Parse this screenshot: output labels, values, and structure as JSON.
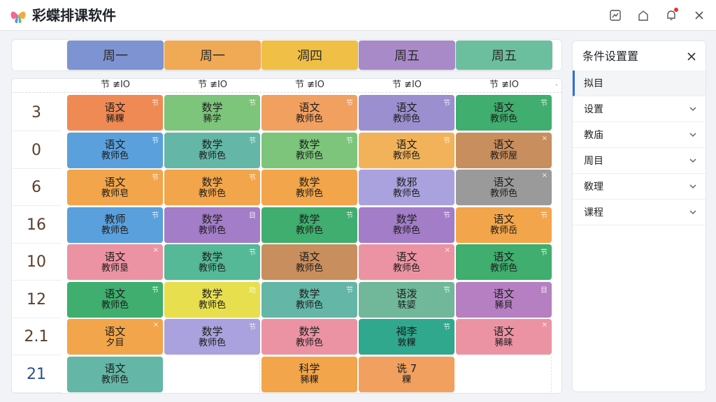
{
  "app": {
    "title": "彩蝶排课软件"
  },
  "colors": {
    "orange": "#f08a55",
    "green": "#7cc57a",
    "amber": "#f2a54a",
    "purple": "#9b8fcf",
    "teal": "#55b896",
    "blue": "#5aa0dc",
    "seagreen": "#64b7a6",
    "brown": "#c98e5d",
    "lavender": "#a79fd9",
    "gray": "#9a9a9a",
    "darkgreen": "#3fae6e",
    "violet": "#a37dc8",
    "pink": "#ec93a3",
    "yellow": "#e8df4f",
    "mauve": "#b67fc2",
    "lightpurple": "#aaa2de",
    "sage": "#71b79a"
  },
  "days": [
    "周一",
    "周一",
    "凋四",
    "周五",
    "周五"
  ],
  "day_colors": [
    "#7e93d1",
    "#f0aa55",
    "#f0bf45",
    "#a98ac9",
    "#6cbf9e"
  ],
  "sub_headers": [
    "节 ≢ΙΟ",
    "节 ≢ΙΟ",
    "节 ≢ΙΟ",
    "节 ≢ΙΟ",
    "节 ≢ΙΟ"
  ],
  "rows": [
    {
      "num": "3",
      "cells": [
        {
          "s": "语文",
          "t": "豨粿",
          "c": "#f08a55",
          "tag": "节"
        },
        {
          "s": "数学",
          "t": "豨学",
          "c": "#7cc57a",
          "tag": "节"
        },
        {
          "s": "语文",
          "t": "教师色",
          "c": "#f2a060",
          "tag": "节"
        },
        {
          "s": "语文",
          "t": "教师色",
          "c": "#9b8fcf",
          "tag": "节"
        },
        {
          "s": "语文",
          "t": "教师色",
          "c": "#3fae6e",
          "tag": "节"
        }
      ]
    },
    {
      "num": "0",
      "cells": [
        {
          "s": "语文",
          "t": "教师色",
          "c": "#5aa0dc",
          "tag": "节"
        },
        {
          "s": "数学",
          "t": "教师色",
          "c": "#64b7a6",
          "tag": "节"
        },
        {
          "s": "数学",
          "t": "教师色",
          "c": "#7cc57a",
          "tag": "节"
        },
        {
          "s": "语文",
          "t": "教师色",
          "c": "#f2b25a",
          "tag": "节"
        },
        {
          "s": "语文",
          "t": "教师屋",
          "c": "#c98e5d",
          "tag": "×"
        }
      ]
    },
    {
      "num": "6",
      "cells": [
        {
          "s": "语文",
          "t": "教师皂",
          "c": "#f2a54a",
          "tag": "节"
        },
        {
          "s": "数学",
          "t": "教师色",
          "c": "#f2a54a",
          "tag": "节"
        },
        {
          "s": "数学",
          "t": "教师色",
          "c": "#f2a54a",
          "tag": ""
        },
        {
          "s": "数邪",
          "t": "教师色",
          "c": "#aaa2de",
          "tag": ""
        },
        {
          "s": "语文",
          "t": "教师色",
          "c": "#9a9a9a",
          "tag": "×"
        }
      ]
    },
    {
      "num": "16",
      "cells": [
        {
          "s": "教师",
          "t": "教师色",
          "c": "#5aa0dc",
          "tag": "节"
        },
        {
          "s": "数学",
          "t": "教师色",
          "c": "#a37dc8",
          "tag": "目"
        },
        {
          "s": "数学",
          "t": "教师色",
          "c": "#3fae6e",
          "tag": "节"
        },
        {
          "s": "数学",
          "t": "教师色",
          "c": "#a37dc8",
          "tag": "节"
        },
        {
          "s": "语文",
          "t": "教师岳",
          "c": "#f2a54a",
          "tag": "节"
        }
      ]
    },
    {
      "num": "10",
      "cells": [
        {
          "s": "语文",
          "t": "教师垦",
          "c": "#ec93a3",
          "tag": "×"
        },
        {
          "s": "数学",
          "t": "教师色",
          "c": "#55b896",
          "tag": "节"
        },
        {
          "s": "语文",
          "t": "教师色",
          "c": "#c98e5d",
          "tag": ""
        },
        {
          "s": "语文",
          "t": "教师色",
          "c": "#ec93a3",
          "tag": "×"
        },
        {
          "s": "语文",
          "t": "教师色",
          "c": "#3fae6e",
          "tag": "节"
        }
      ]
    },
    {
      "num": "12",
      "cells": [
        {
          "s": "语文",
          "t": "教师色",
          "c": "#3fae6e",
          "tag": "节"
        },
        {
          "s": "数学",
          "t": "教师色",
          "c": "#e8df4f",
          "tag": "劝"
        },
        {
          "s": "数学",
          "t": "教师色",
          "c": "#64b7a6",
          "tag": "节"
        },
        {
          "s": "语泼",
          "t": "轶媭",
          "c": "#71b79a",
          "tag": "节"
        },
        {
          "s": "语文",
          "t": "豨貝",
          "c": "#b67fc2",
          "tag": "目"
        }
      ]
    },
    {
      "num": "2.1",
      "cells": [
        {
          "s": "语文",
          "t": "夕目",
          "c": "#f2a54a",
          "tag": "×"
        },
        {
          "s": "数学",
          "t": "教师色",
          "c": "#aaa2de",
          "tag": "节"
        },
        {
          "s": "数学",
          "t": "教师色",
          "c": "#ec93a3",
          "tag": ""
        },
        {
          "s": "褐李",
          "t": "敦粿",
          "c": "#2fa88e",
          "tag": "节"
        },
        {
          "s": "语文",
          "t": "豨睐",
          "c": "#ec93a3",
          "tag": "×"
        }
      ]
    },
    {
      "num": "21",
      "blue": true,
      "cells": [
        {
          "s": "语文",
          "t": "教师色",
          "c": "#64b7a6",
          "tag": ""
        },
        null,
        {
          "s": "科学",
          "t": "豨粿",
          "c": "#f2a54a",
          "tag": ""
        },
        {
          "s": "诜 7",
          "t": "粿",
          "c": "#f2a060",
          "tag": ""
        },
        null
      ]
    }
  ],
  "side_panel": {
    "title": "条件设置置",
    "items": [
      {
        "label": "拟目",
        "active": true,
        "chevron": false
      },
      {
        "label": "设置",
        "active": false,
        "chevron": true
      },
      {
        "label": "教庙",
        "active": false,
        "chevron": true
      },
      {
        "label": "周目",
        "active": false,
        "chevron": true
      },
      {
        "label": "敎理",
        "active": false,
        "chevron": true
      },
      {
        "label": "课程",
        "active": false,
        "chevron": true
      }
    ]
  }
}
